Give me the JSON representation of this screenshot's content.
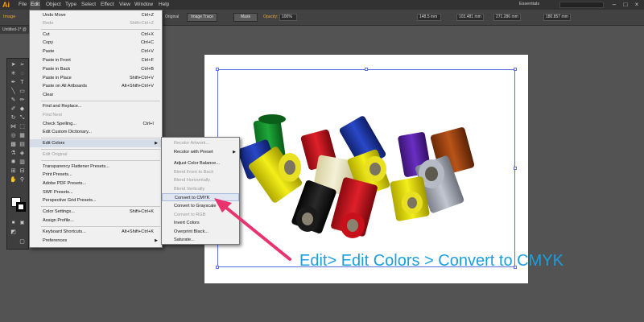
{
  "app": {
    "logo": "Ai"
  },
  "menubar": {
    "items": [
      "File",
      "Edit",
      "Object",
      "Type",
      "Select",
      "Effect",
      "View",
      "Window",
      "Help"
    ],
    "workspace": "Essentials"
  },
  "controlbar": {
    "selection_label": "Image",
    "original_label": "Original",
    "image_trace": "Image Trace",
    "mask": "Mask",
    "opacity_label": "Opacity:",
    "opacity_value": "100%",
    "x_value": "148.5 mm",
    "y_value": "103.481 mm",
    "w_value": "271.286 mm",
    "h_value": "180.857 mm"
  },
  "document": {
    "tab": "Untitled-1* @"
  },
  "edit_menu": {
    "items": [
      {
        "label": "Undo Move",
        "shortcut": "Ctrl+Z",
        "enabled": true
      },
      {
        "label": "Redo",
        "shortcut": "Shift+Ctrl+Z",
        "enabled": false
      },
      {
        "label": "Cut",
        "shortcut": "Ctrl+X",
        "enabled": true
      },
      {
        "label": "Copy",
        "shortcut": "Ctrl+C",
        "enabled": true
      },
      {
        "label": "Paste",
        "shortcut": "Ctrl+V",
        "enabled": true
      },
      {
        "label": "Paste in Front",
        "shortcut": "Ctrl+F",
        "enabled": true
      },
      {
        "label": "Paste in Back",
        "shortcut": "Ctrl+B",
        "enabled": true
      },
      {
        "label": "Paste in Place",
        "shortcut": "Shift+Ctrl+V",
        "enabled": true
      },
      {
        "label": "Paste on All Artboards",
        "shortcut": "Alt+Shift+Ctrl+V",
        "enabled": true
      },
      {
        "label": "Clear",
        "shortcut": "",
        "enabled": true
      },
      {
        "label": "Find and Replace...",
        "shortcut": "",
        "enabled": true
      },
      {
        "label": "Find Next",
        "shortcut": "",
        "enabled": false
      },
      {
        "label": "Check Spelling...",
        "shortcut": "Ctrl+I",
        "enabled": true
      },
      {
        "label": "Edit Custom Dictionary...",
        "shortcut": "",
        "enabled": true
      },
      {
        "label": "Edit Colors",
        "shortcut": "",
        "enabled": true
      },
      {
        "label": "Edit Original",
        "shortcut": "",
        "enabled": false
      },
      {
        "label": "Transparency Flattener Presets...",
        "shortcut": "",
        "enabled": true
      },
      {
        "label": "Print Presets...",
        "shortcut": "",
        "enabled": true
      },
      {
        "label": "Adobe PDF Presets...",
        "shortcut": "",
        "enabled": true
      },
      {
        "label": "SWF Presets...",
        "shortcut": "",
        "enabled": true
      },
      {
        "label": "Perspective Grid Presets...",
        "shortcut": "",
        "enabled": true
      },
      {
        "label": "Color Settings...",
        "shortcut": "Shift+Ctrl+K",
        "enabled": true
      },
      {
        "label": "Assign Profile...",
        "shortcut": "",
        "enabled": true
      },
      {
        "label": "Keyboard Shortcuts...",
        "shortcut": "Alt+Shift+Ctrl+K",
        "enabled": true
      },
      {
        "label": "Preferences",
        "shortcut": "",
        "enabled": true
      }
    ]
  },
  "edit_colors_submenu": {
    "items": [
      {
        "label": "Recolor Artwork...",
        "enabled": false
      },
      {
        "label": "Recolor with Preset",
        "enabled": true
      },
      {
        "label": "Adjust Color Balance...",
        "enabled": true
      },
      {
        "label": "Blend Front to Back",
        "enabled": false
      },
      {
        "label": "Blend Horizontally",
        "enabled": false
      },
      {
        "label": "Blend Vertically",
        "enabled": false
      },
      {
        "label": "Convert to CMYK",
        "enabled": true
      },
      {
        "label": "Convert to Grayscale",
        "enabled": true
      },
      {
        "label": "Convert to RGB",
        "enabled": false
      },
      {
        "label": "Invert Colors",
        "enabled": true
      },
      {
        "label": "Overprint Black...",
        "enabled": true
      },
      {
        "label": "Saturate...",
        "enabled": true
      }
    ]
  },
  "annotation": {
    "text": "Edit> Edit Colors > Convert to CMYK",
    "color": "#1a9fdc",
    "arrow_color": "#e8336f"
  },
  "spools": [
    "green",
    "blue",
    "red",
    "purple",
    "brown",
    "yellow",
    "cream",
    "gray",
    "black",
    "red",
    "yellow"
  ]
}
